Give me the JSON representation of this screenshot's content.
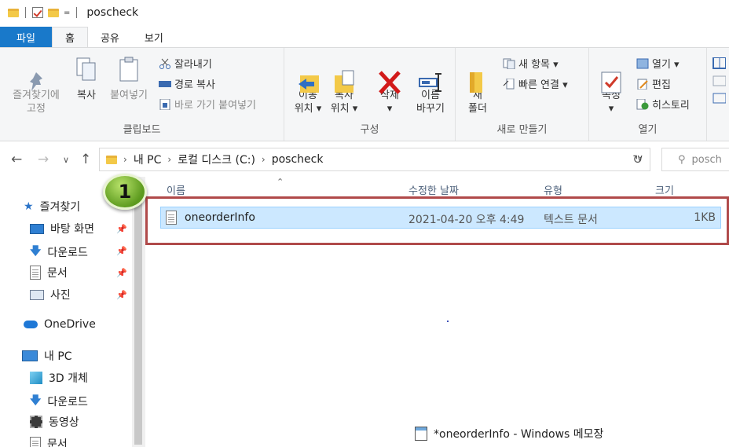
{
  "window": {
    "title": "poscheck",
    "qat_caret": "="
  },
  "tabs": [
    "파일",
    "홈",
    "공유",
    "보기"
  ],
  "ribbon": {
    "clipboard": {
      "group_label": "클립보드",
      "pin_label": "즐겨찾기에\n고정",
      "copy_label": "복사",
      "paste_label": "붙여넣기",
      "cut_label": "잘라내기",
      "copy_path_label": "경로 복사",
      "paste_shortcut_label": "바로 가기 붙여넣기"
    },
    "organize": {
      "group_label": "구성",
      "move_to_label": "이동\n위치 ▾",
      "copy_to_label": "복사\n위치 ▾",
      "delete_label": "삭제\n▾",
      "rename_label": "이름\n바꾸기"
    },
    "new": {
      "group_label": "새로 만들기",
      "new_folder_label": "새\n폴더",
      "new_item_label": "새 항목 ▾",
      "easy_access_label": "빠른 연결 ▾"
    },
    "open": {
      "group_label": "열기",
      "properties_label": "속성\n▾",
      "open_label": "열기 ▾",
      "edit_label": "편집",
      "history_label": "히스토리"
    }
  },
  "address": {
    "crumbs": [
      "내 PC",
      "로컬 디스크 (C:)",
      "poscheck"
    ],
    "search_placeholder": "posch"
  },
  "nav": {
    "quick_access": "즐겨찾기",
    "items": [
      {
        "label": "바탕 화면",
        "icon": "desktop-icon",
        "pinned": true
      },
      {
        "label": "다운로드",
        "icon": "download-icon",
        "pinned": true
      },
      {
        "label": "문서",
        "icon": "document-icon",
        "pinned": true
      },
      {
        "label": "사진",
        "icon": "picture-icon",
        "pinned": true
      }
    ],
    "onedrive": "OneDrive",
    "this_pc": "내 PC",
    "pc_items": [
      {
        "label": "3D 개체",
        "icon": "3d-objects-icon"
      },
      {
        "label": "다운로드",
        "icon": "download-icon"
      },
      {
        "label": "동영상",
        "icon": "video-icon"
      },
      {
        "label": "문서",
        "icon": "document-icon"
      }
    ]
  },
  "columns": {
    "name": "이름",
    "date": "수정한 날짜",
    "type": "유형",
    "size": "크기"
  },
  "files": [
    {
      "name": "oneorderInfo",
      "date": "2021-04-20 오후 4:49",
      "type": "텍스트 문서",
      "size": "1KB"
    }
  ],
  "annotation": {
    "number": "1",
    "color": "#b04a4a"
  },
  "taskbar_popup": "*oneorderInfo - Windows 메모장",
  "colors": {
    "accent": "#1979ca",
    "selection": "#cce8ff",
    "highlight_box": "#b04a4a"
  }
}
